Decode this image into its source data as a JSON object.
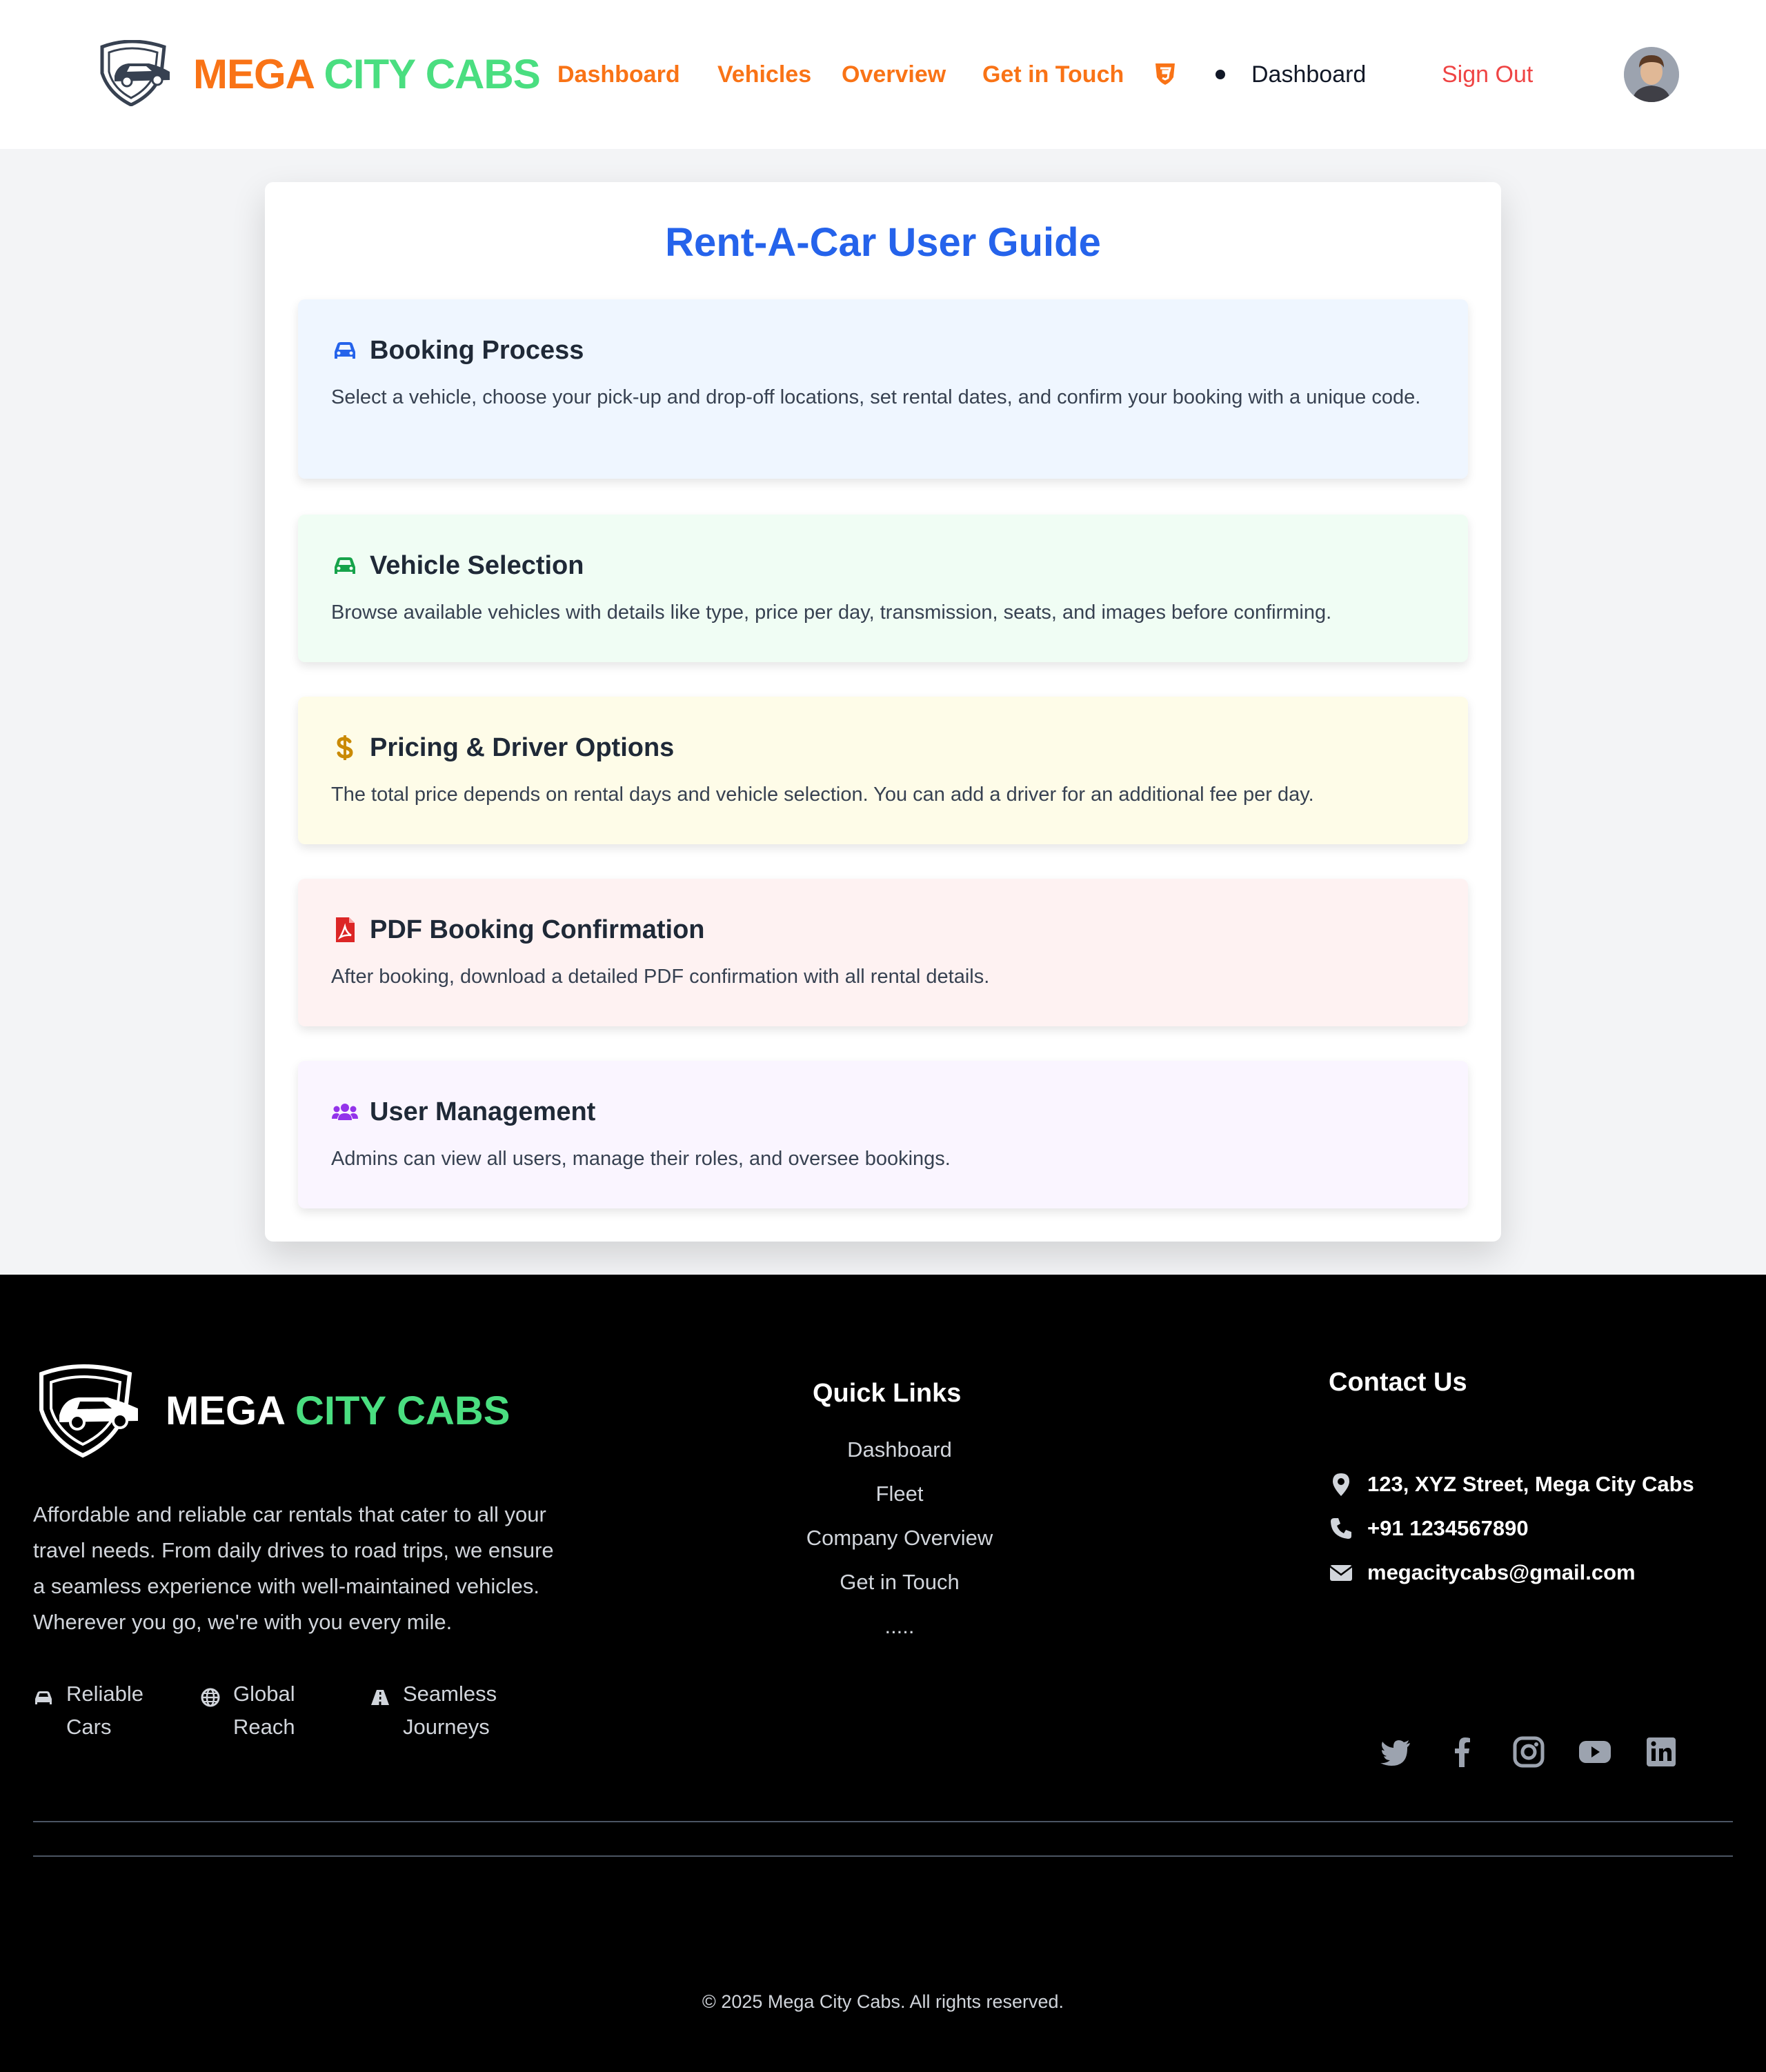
{
  "header": {
    "brand_part1": "MEGA ",
    "brand_part2": "CITY CABS",
    "nav": [
      {
        "label": "Dashboard"
      },
      {
        "label": "Vehicles"
      },
      {
        "label": "Overview"
      },
      {
        "label": "Get in Touch"
      }
    ],
    "current_page": "Dashboard",
    "sign_out": "Sign Out"
  },
  "guide": {
    "title": "Rent-A-Car User Guide",
    "sections": [
      {
        "icon": "car-icon",
        "title": "Booking Process",
        "text": "Select a vehicle, choose your pick-up and drop-off locations, set rental dates, and confirm your booking with a unique code.",
        "bg": "#eff6ff",
        "accent": "#2563eb"
      },
      {
        "icon": "car-icon",
        "title": "Vehicle Selection",
        "text": "Browse available vehicles with details like type, price per day, transmission, seats, and images before confirming.",
        "bg": "#f0fdf4",
        "accent": "#16a34a"
      },
      {
        "icon": "dollar-icon",
        "title": "Pricing & Driver Options",
        "text": "The total price depends on rental days and vehicle selection. You can add a driver for an additional fee per day.",
        "bg": "#fefce8",
        "accent": "#ca8a04"
      },
      {
        "icon": "pdf-icon",
        "title": "PDF Booking Confirmation",
        "text": "After booking, download a detailed PDF confirmation with all rental details.",
        "bg": "#fef2f2",
        "accent": "#dc2626"
      },
      {
        "icon": "users-icon",
        "title": "User Management",
        "text": "Admins can view all users, manage their roles, and oversee bookings.",
        "bg": "#faf5ff",
        "accent": "#9333ea"
      }
    ]
  },
  "footer": {
    "brand_part1": "MEGA ",
    "brand_part2": "CITY CABS",
    "about": "Affordable and reliable car rentals that cater to all your travel needs. From daily drives to road trips, we ensure a seamless experience with well-maintained vehicles. Wherever you go, we're with you every mile.",
    "features": [
      {
        "icon": "car-icon",
        "label": "Reliable Cars"
      },
      {
        "icon": "globe-icon",
        "label": "Global Reach"
      },
      {
        "icon": "road-icon",
        "label": "Seamless Journeys"
      }
    ],
    "quick_links_title": "Quick Links",
    "quick_links": [
      "Dashboard",
      "Fleet",
      "Company Overview",
      "Get in Touch",
      "....."
    ],
    "contact_title": "Contact Us",
    "contact": [
      {
        "icon": "location-pin-icon",
        "text": "123, XYZ Street, Mega City Cabs"
      },
      {
        "icon": "phone-icon",
        "text": "+91 1234567890"
      },
      {
        "icon": "envelope-icon",
        "text": "megacitycabs@gmail.com"
      }
    ],
    "social": [
      "twitter-icon",
      "facebook-icon",
      "instagram-icon",
      "youtube-icon",
      "linkedin-icon"
    ],
    "copyright": "© 2025 Mega City Cabs. All rights reserved."
  }
}
